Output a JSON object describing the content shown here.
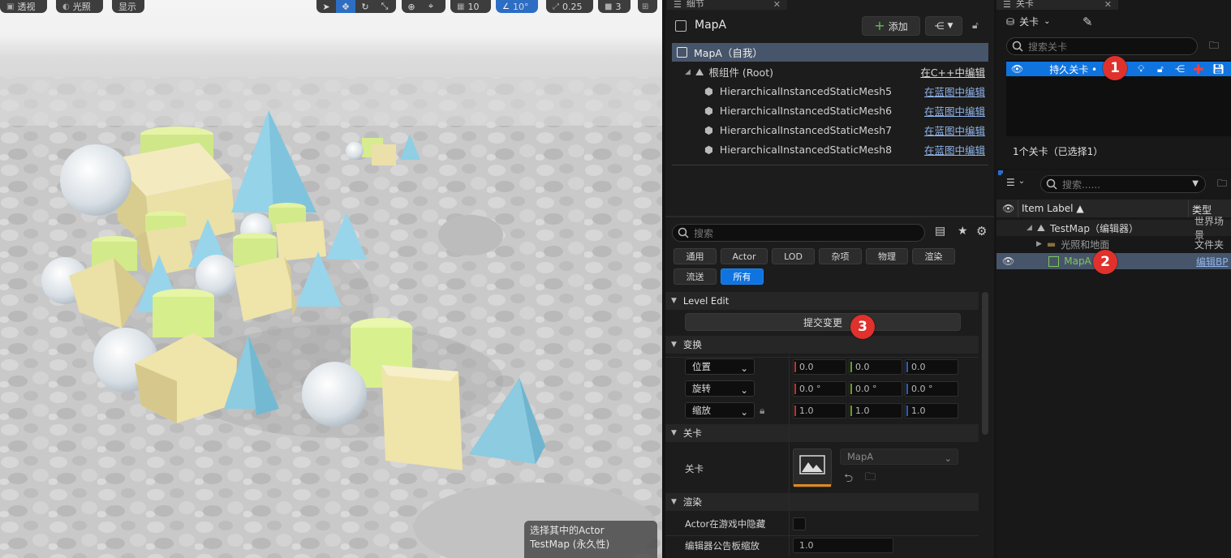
{
  "viewport": {
    "buttons": [
      "透视",
      "光照",
      "显示"
    ],
    "toolbar": {
      "grid_snap": "10",
      "rotate_snap": "10°",
      "scale_snap": "0.25",
      "camera_speed": "3"
    },
    "status_line1": "选择其中的Actor",
    "status_line2": "TestMap (永久性)"
  },
  "details": {
    "tab_label": "细节",
    "actor_name": "MapA",
    "add_label": "添加",
    "tree": [
      {
        "label": "MapA（自我）",
        "action": ""
      },
      {
        "label": "根组件 (Root)",
        "action": "在C++中编辑"
      },
      {
        "label": "HierarchicalInstancedStaticMesh5",
        "action": "在蓝图中编辑"
      },
      {
        "label": "HierarchicalInstancedStaticMesh6",
        "action": "在蓝图中编辑"
      },
      {
        "label": "HierarchicalInstancedStaticMesh7",
        "action": "在蓝图中编辑"
      },
      {
        "label": "HierarchicalInstancedStaticMesh8",
        "action": "在蓝图中编辑"
      }
    ],
    "search_placeholder": "搜索",
    "filters": [
      "通用",
      "Actor",
      "LOD",
      "杂项",
      "物理",
      "渲染",
      "流送",
      "所有"
    ],
    "active_filter": "所有",
    "sections": {
      "level_edit": "Level Edit",
      "commit_label": "提交变更",
      "transform": "变换",
      "level": "关卡",
      "rendering": "渲染"
    },
    "transform": {
      "location": {
        "label": "位置",
        "x": "0.0",
        "y": "0.0",
        "z": "0.0"
      },
      "rotation": {
        "label": "旋转",
        "x": "0.0 °",
        "y": "0.0 °",
        "z": "0.0 °"
      },
      "scale": {
        "label": "缩放",
        "x": "1.0",
        "y": "1.0",
        "z": "1.0"
      }
    },
    "level_prop": {
      "label": "关卡",
      "value": "MapA"
    },
    "render_props": [
      {
        "label": "Actor在游戏中隐藏",
        "value": ""
      },
      {
        "label": "编辑器公告板缩放",
        "value": "1.0"
      }
    ]
  },
  "levels": {
    "tab_label": "关卡",
    "menu_label": "关卡",
    "search_placeholder": "搜索关卡",
    "row_label": "持久关卡 •",
    "footer": "1个关卡（已选择1）"
  },
  "outliner": {
    "search_placeholder": "搜索......",
    "col_label": "Item Label ▲",
    "col_type": "类型",
    "rows": [
      {
        "label": "TestMap（编辑器）",
        "type": "世界场景"
      },
      {
        "label": "光照和地面",
        "type": "文件夹"
      },
      {
        "label": "MapA",
        "type": "编辑BP"
      }
    ]
  },
  "annotations": [
    "1",
    "2",
    "3"
  ],
  "colors": {
    "accent_blue": "#0f74df",
    "selection": "#47556a",
    "badge_red": "#e0312c",
    "link_blue": "#8fb4ea"
  }
}
